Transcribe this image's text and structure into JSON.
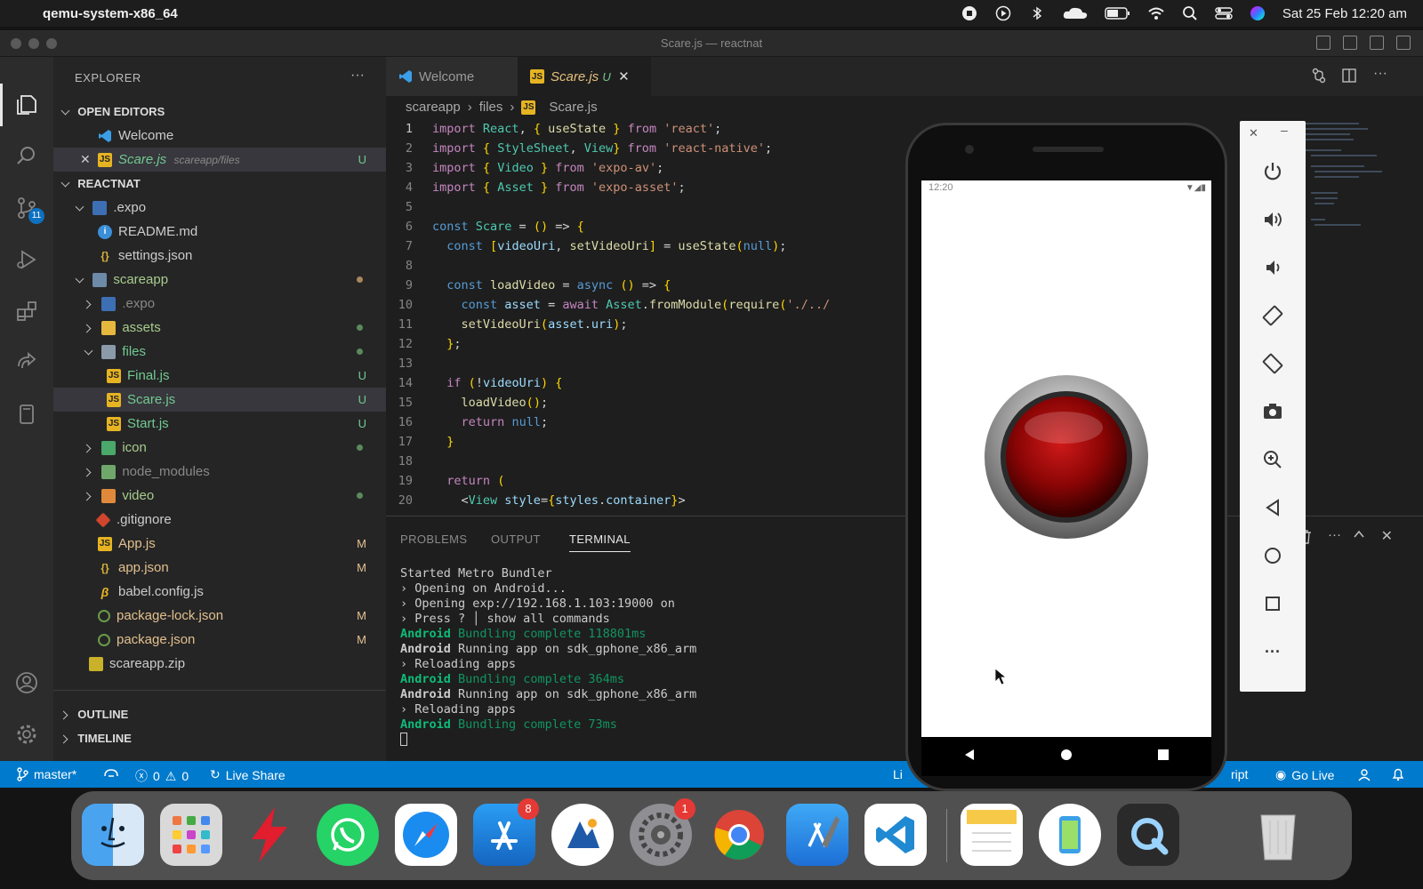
{
  "menubar": {
    "app_name": "qemu-system-x86_64",
    "datetime": "Sat 25 Feb  12:20 am"
  },
  "window": {
    "title": "Scare.js — reactnat"
  },
  "activity": {
    "scm_badge": "11"
  },
  "sidebar": {
    "header": "EXPLORER",
    "more": "···",
    "open_editors_label": "OPEN EDITORS",
    "open_editors": [
      {
        "name": "Welcome",
        "path": "",
        "status": ""
      },
      {
        "name": "Scare.js",
        "path": "scareapp/files",
        "status": "U"
      }
    ],
    "project_label": "REACTNAT",
    "tree": [
      {
        "name": ".expo",
        "status": ""
      },
      {
        "name": "README.md",
        "status": ""
      },
      {
        "name": "settings.json",
        "status": ""
      },
      {
        "name": "scareapp",
        "status": ""
      },
      {
        "name": ".expo",
        "status": ""
      },
      {
        "name": "assets",
        "status": ""
      },
      {
        "name": "files",
        "status": ""
      },
      {
        "name": "Final.js",
        "status": "U"
      },
      {
        "name": "Scare.js",
        "status": "U"
      },
      {
        "name": "Start.js",
        "status": "U"
      },
      {
        "name": "icon",
        "status": ""
      },
      {
        "name": "node_modules",
        "status": ""
      },
      {
        "name": "video",
        "status": ""
      },
      {
        "name": ".gitignore",
        "status": ""
      },
      {
        "name": "App.js",
        "status": "M"
      },
      {
        "name": "app.json",
        "status": "M"
      },
      {
        "name": "babel.config.js",
        "status": ""
      },
      {
        "name": "package-lock.json",
        "status": "M"
      },
      {
        "name": "package.json",
        "status": "M"
      },
      {
        "name": "scareapp.zip",
        "status": ""
      }
    ],
    "outline_label": "OUTLINE",
    "timeline_label": "TIMELINE"
  },
  "tabs": {
    "welcome": "Welcome",
    "scare": "Scare.js",
    "scare_status": "U"
  },
  "breadcrumb": [
    "scareapp",
    "files",
    "Scare.js"
  ],
  "editor": {
    "lines": [
      "import React, { useState } from 'react';",
      "import { StyleSheet, View} from 'react-native';",
      "import { Video } from 'expo-av';",
      "import { Asset } from 'expo-asset';",
      "",
      "const Scare = () => {",
      "  const [videoUri, setVideoUri] = useState(null);",
      "",
      "  const loadVideo = async () => {",
      "    const asset = await Asset.fromModule(require('./../",
      "    setVideoUri(asset.uri);",
      "  };",
      "",
      "  if (!videoUri) {",
      "    loadVideo();",
      "    return null;",
      "  }",
      "",
      "  return (",
      "    <View style={styles.container}>"
    ]
  },
  "panel": {
    "tabs": [
      "PROBLEMS",
      "OUTPUT",
      "TERMINAL"
    ],
    "terminal": [
      "Started Metro Bundler",
      "› Opening on Android...",
      "› Opening exp://192.168.1.103:19000 on",
      "› Press ? │ show all commands",
      "Android Bundling complete 118801ms",
      "Android Running app on sdk_gphone_x86_arm",
      "› Reloading apps",
      "Android Bundling complete 364ms",
      "Android Running app on sdk_gphone_x86_arm",
      "› Reloading apps",
      "Android Bundling complete 73ms"
    ]
  },
  "statusbar": {
    "branch": "master*",
    "errors": "0",
    "warnings": "0",
    "live_share": "Live Share",
    "left_cut": "Li",
    "language": "ript",
    "go_live": "Go Live"
  },
  "phone": {
    "time": "12:20"
  },
  "dock": {
    "appstore_badge": "8",
    "settings_badge": "1",
    "apps": [
      "finder-icon",
      "launchpad-icon",
      "bolt-icon",
      "whatsapp-icon",
      "safari-icon",
      "app-store-icon",
      "gallery-icon",
      "system-settings-icon",
      "chrome-icon",
      "xcode-icon",
      "vscode-icon",
      "notes-icon",
      "simulator-icon",
      "quicktime-icon",
      "trash-icon"
    ]
  }
}
